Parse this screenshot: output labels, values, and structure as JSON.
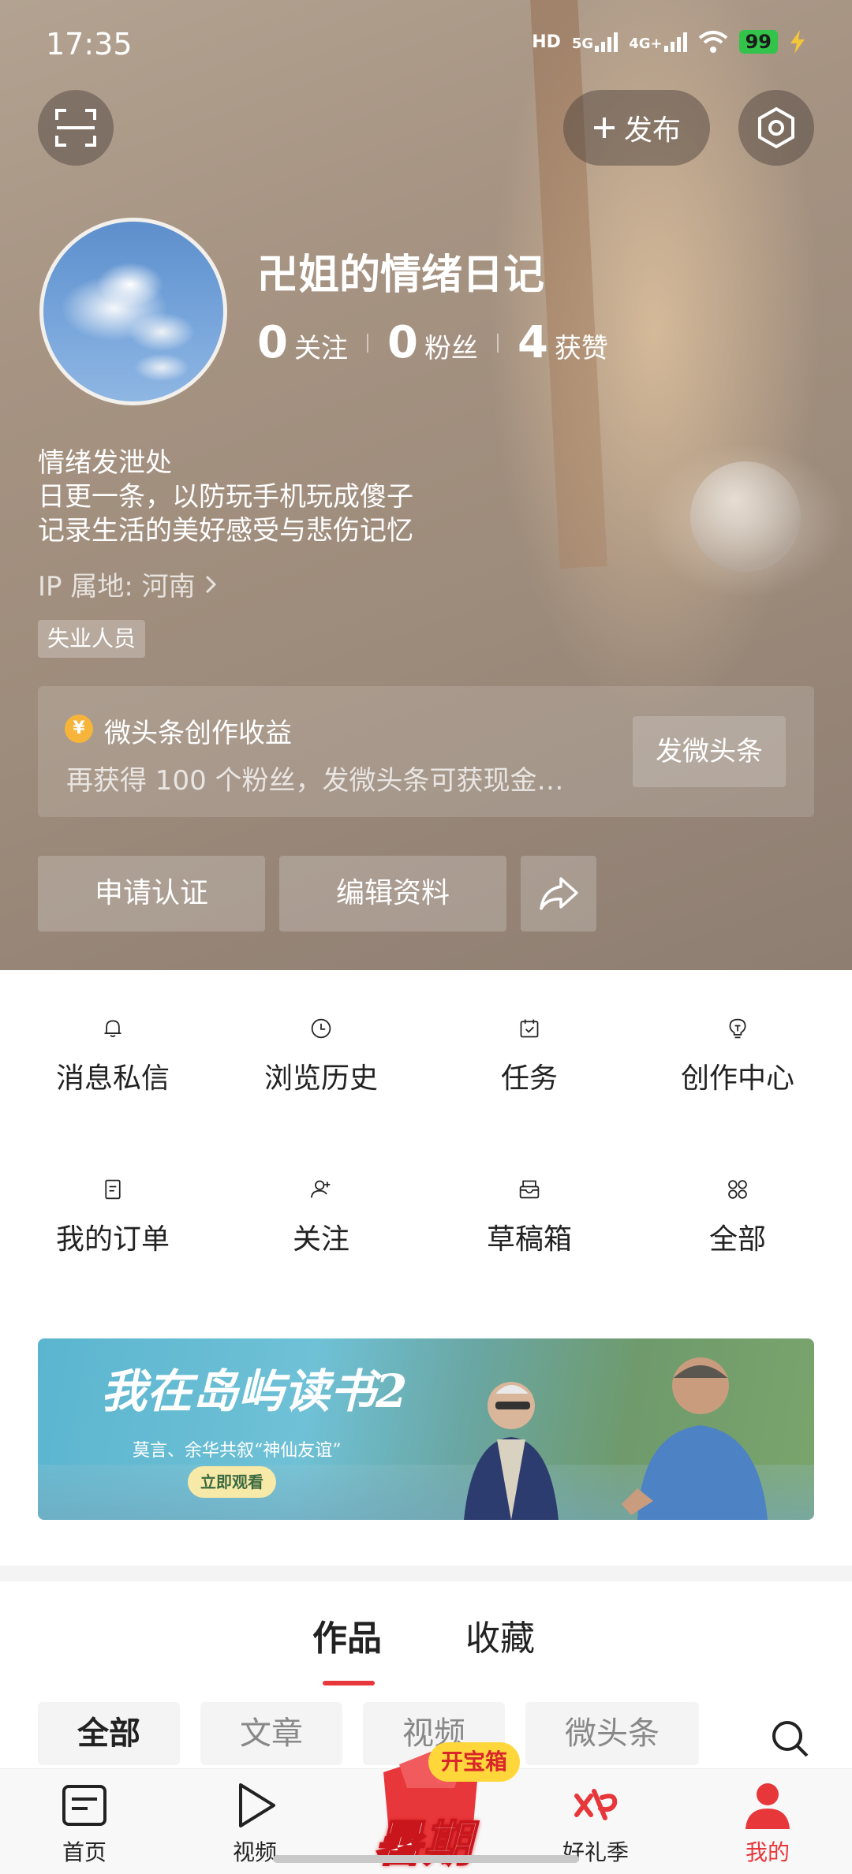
{
  "status_bar": {
    "time": "17:35",
    "hd": "HD",
    "net1": "5G",
    "net2": "4G+",
    "battery": "99"
  },
  "header": {
    "publish_label": "发布"
  },
  "profile": {
    "name": "卍姐的情绪日记",
    "stats": [
      {
        "num": "0",
        "label": "关注"
      },
      {
        "num": "0",
        "label": "粉丝"
      },
      {
        "num": "4",
        "label": "获赞"
      }
    ],
    "bio": [
      "情绪发泄处",
      "日更一条，以防玩手机玩成傻子",
      "记录生活的美好感受与悲伤记忆"
    ],
    "ip": "IP 属地: 河南",
    "tag": "失业人员"
  },
  "earn_card": {
    "coin": "¥",
    "title": "微头条创作收益",
    "desc": "再获得 100 个粉丝，发微头条可获现金…",
    "button": "发微头条"
  },
  "actions": {
    "verify": "申请认证",
    "edit": "编辑资料"
  },
  "grid": [
    {
      "label": "消息私信",
      "icon": "bell-icon"
    },
    {
      "label": "浏览历史",
      "icon": "clock-icon"
    },
    {
      "label": "任务",
      "icon": "calendar-check-icon"
    },
    {
      "label": "创作中心",
      "icon": "bulb-icon"
    },
    {
      "label": "我的订单",
      "icon": "order-icon"
    },
    {
      "label": "关注",
      "icon": "add-user-icon"
    },
    {
      "label": "草稿箱",
      "icon": "inbox-icon"
    },
    {
      "label": "全部",
      "icon": "apps-icon"
    }
  ],
  "banner": {
    "title": "我在岛屿读书2",
    "subtitle": "莫言、余华共叙“神仙友谊”",
    "cta": "立即观看"
  },
  "content_tabs": [
    {
      "label": "作品"
    },
    {
      "label": "收藏"
    }
  ],
  "filter_chips": [
    {
      "label": "全部"
    },
    {
      "label": "文章"
    },
    {
      "label": "视频"
    },
    {
      "label": "微头条"
    }
  ],
  "bottom_nav": [
    {
      "label": "首页",
      "icon": "home-doc-icon"
    },
    {
      "label": "视频",
      "icon": "play-icon"
    },
    {
      "label": "好礼季",
      "icon": "gift-logo-icon"
    },
    {
      "label": "我的",
      "icon": "person-icon"
    }
  ],
  "promo": {
    "badge": "开宝箱",
    "text": "暑期"
  },
  "colors": {
    "accent": "#e8373a",
    "coin": "#f6b43a",
    "battery": "#33c24a"
  }
}
